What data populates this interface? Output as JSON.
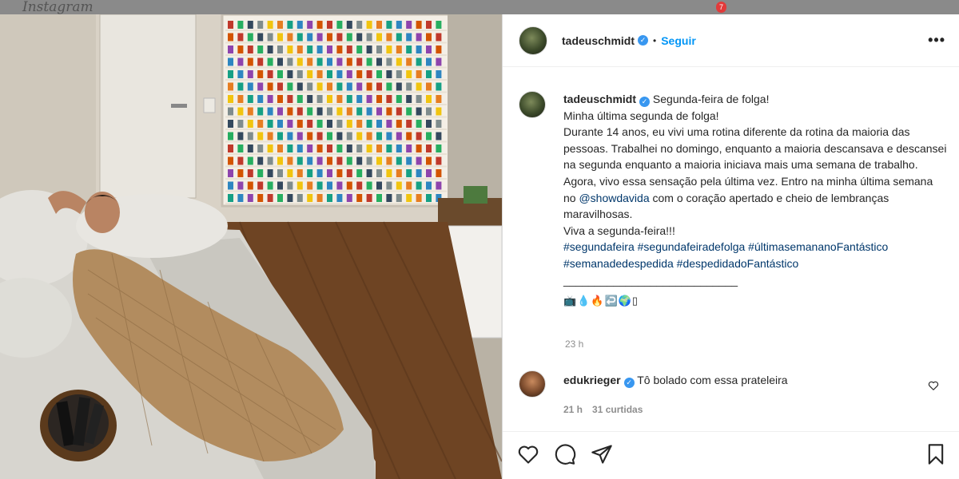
{
  "app": {
    "logo_text": "Instagram",
    "notifications_count": "7"
  },
  "post": {
    "username": "tadeuschmidt",
    "follow_label": "Seguir",
    "more_label": "•••",
    "caption_lines": [
      "Segunda-feira de folga!",
      "Minha última segunda de folga!",
      "Durante 14 anos, eu vivi uma rotina diferente da rotina da maioria das pessoas. Trabalhei no domingo, enquanto a maioria descansava e descansei na segunda enquanto a maioria iniciava mais uma semana de trabalho.",
      "Agora, vivo essa sensação pela última vez. Entro na minha última semana no",
      "@showdavida",
      "com o coração apertado e cheio de lembranças maravilhosas.",
      "Viva a segunda-feira!!!",
      "#segundafeira #segundafeiradefolga #últimasemananoFantástico #semanadedespedida #despedidadoFantástico",
      "____________________________",
      "📺💧🔥↩️🌍▯"
    ],
    "time": "23 h"
  },
  "comment": {
    "username": "edukrieger",
    "text": "Tô bolado com essa prateleira",
    "time": "21 h",
    "likes": "31 curtidas"
  },
  "colors": {
    "accent": "#0095f6",
    "verified": "#3897f0",
    "link": "#00376b"
  },
  "icons": [
    "heart-icon",
    "comment-icon",
    "share-icon",
    "bookmark-icon",
    "verified-icon",
    "more-icon"
  ]
}
